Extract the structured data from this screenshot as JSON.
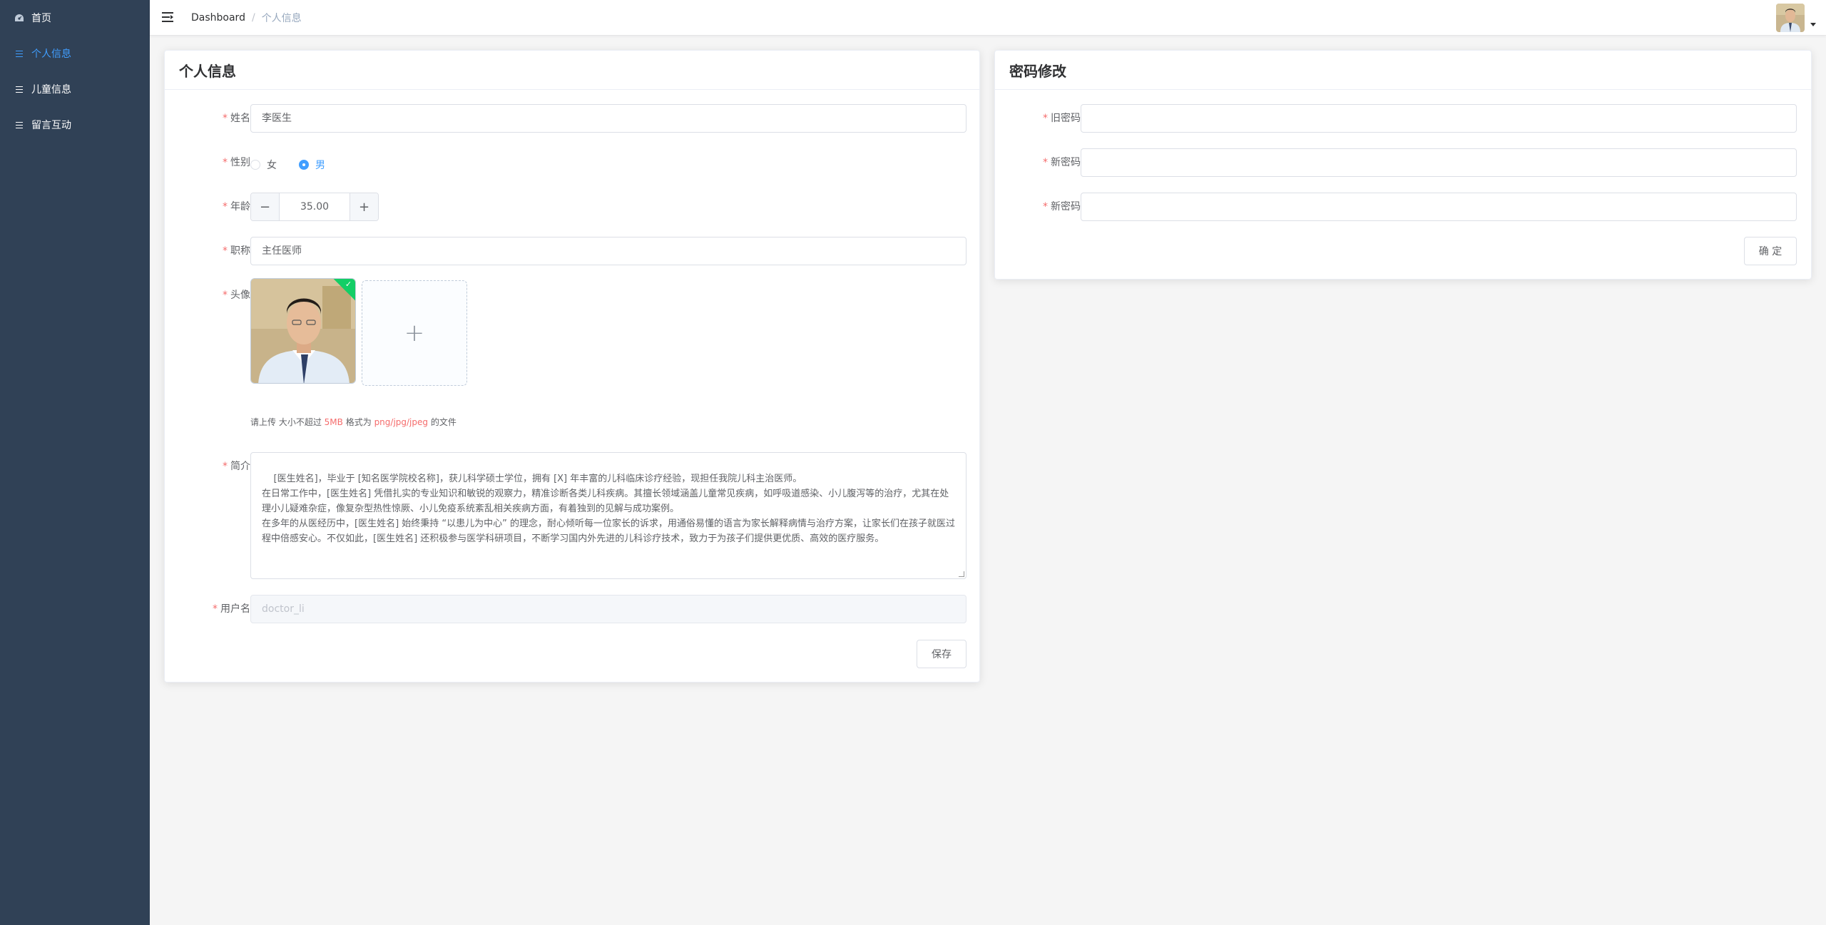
{
  "sidebar": {
    "items": [
      {
        "label": "首页",
        "icon": "dashboard-icon",
        "active": false
      },
      {
        "label": "个人信息",
        "icon": "list-icon",
        "active": true
      },
      {
        "label": "儿童信息",
        "icon": "list-icon",
        "active": false
      },
      {
        "label": "留言互动",
        "icon": "list-icon",
        "active": false
      }
    ]
  },
  "navbar": {
    "breadcrumb_home": "Dashboard",
    "breadcrumb_sep": "/",
    "breadcrumb_current": "个人信息"
  },
  "profile_card": {
    "title": "个人信息",
    "name_label": "姓名",
    "name_value": "李医生",
    "gender_label": "性别",
    "gender_options": [
      "女",
      "男"
    ],
    "gender_selected": "男",
    "age_label": "年龄",
    "age_value": "35.00",
    "age_minus": "−",
    "age_plus": "+",
    "title_label": "职称",
    "title_value": "主任医师",
    "avatar_label": "头像",
    "upload_plus": "+",
    "upload_check": "✓",
    "upload_tip_prefix": "请上传 大小不超过",
    "upload_tip_size": "5MB",
    "upload_tip_mid": "格式为",
    "upload_tip_formats": "png/jpg/jpeg",
    "upload_tip_suffix": "的文件",
    "intro_label": "简介",
    "intro_value": "[医生姓名]，毕业于 [知名医学院校名称]，获儿科学硕士学位，拥有 [X] 年丰富的儿科临床诊疗经验，现担任我院儿科主治医师。\n在日常工作中，[医生姓名] 凭借扎实的专业知识和敏锐的观察力，精准诊断各类儿科疾病。其擅长领域涵盖儿童常见疾病，如呼吸道感染、小儿腹泻等的治疗，尤其在处理小儿疑难杂症，像复杂型热性惊厥、小儿免疫系统紊乱相关疾病方面，有着独到的见解与成功案例。\n在多年的从医经历中，[医生姓名] 始终秉持 “以患儿为中心” 的理念，耐心倾听每一位家长的诉求，用通俗易懂的语言为家长解释病情与治疗方案，让家长们在孩子就医过程中倍感安心。不仅如此，[医生姓名] 还积极参与医学科研项目，不断学习国内外先进的儿科诊疗技术，致力于为孩子们提供更优质、高效的医疗服务。",
    "username_label": "用户名",
    "username_value": "doctor_li",
    "save_label": "保存"
  },
  "password_card": {
    "title": "密码修改",
    "old_label": "旧密码",
    "new_label": "新密码",
    "confirm_label": "新密码",
    "old_value": "",
    "new_value": "",
    "confirm_value": "",
    "submit_label": "确 定"
  },
  "colors": {
    "sidebar_bg": "#304156",
    "accent": "#409eff",
    "required": "#f56c6c",
    "success": "#13ce66"
  }
}
